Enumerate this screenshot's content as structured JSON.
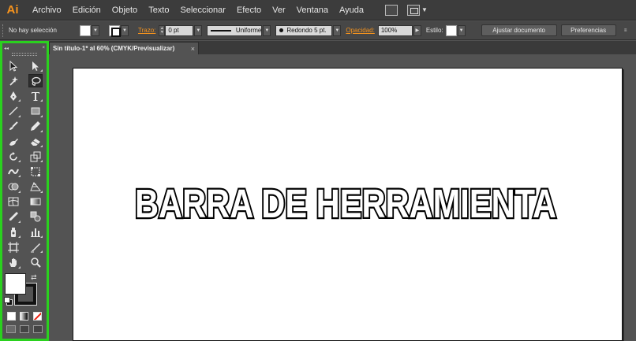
{
  "menubar": {
    "logo": "Ai",
    "items": [
      "Archivo",
      "Edición",
      "Objeto",
      "Texto",
      "Seleccionar",
      "Efecto",
      "Ver",
      "Ventana",
      "Ayuda"
    ]
  },
  "control_bar": {
    "selection_status": "No hay selección",
    "stroke_link": "Trazo:",
    "stroke_weight": "0 pt",
    "stroke_profile": "Uniforme",
    "brush": "Redondo 5 pt.",
    "opacity_link": "Opacidad:",
    "opacity_value": "100%",
    "style_label": "Estilo:",
    "document_setup_button": "Ajustar documento",
    "preferences_button": "Preferencias"
  },
  "document_tab": {
    "title": "Sin título-1* al 60% (CMYK/Previsualizar)",
    "close": "×"
  },
  "toolbar": {
    "collapse_glyph": "◂◂",
    "close_glyph": "×",
    "tools": [
      [
        "selection-tool",
        "direct-selection-tool"
      ],
      [
        "magic-wand-tool",
        "lasso-tool"
      ],
      [
        "pen-tool",
        "type-tool"
      ],
      [
        "line-segment-tool",
        "rectangle-tool"
      ],
      [
        "paintbrush-tool",
        "pencil-tool"
      ],
      [
        "blob-brush-tool",
        "eraser-tool"
      ],
      [
        "rotate-tool",
        "scale-tool"
      ],
      [
        "width-tool",
        "free-transform-tool"
      ],
      [
        "shape-builder-tool",
        "perspective-grid-tool"
      ],
      [
        "mesh-tool",
        "gradient-tool"
      ],
      [
        "eyedropper-tool",
        "blend-tool"
      ],
      [
        "symbol-sprayer-tool",
        "column-graph-tool"
      ],
      [
        "artboard-tool",
        "slice-tool"
      ],
      [
        "hand-tool",
        "zoom-tool"
      ]
    ],
    "active_tool": "lasso-tool",
    "fill_color": "#ffffff",
    "stroke_color": "#000000"
  },
  "canvas": {
    "artwork_text": "BARRA DE HERRAMIENTA"
  },
  "colors": {
    "accent_orange": "#f7941d",
    "highlight_green": "#2ad11e",
    "panel_gray": "#535353",
    "menubar_gray": "#3c3c3c"
  }
}
